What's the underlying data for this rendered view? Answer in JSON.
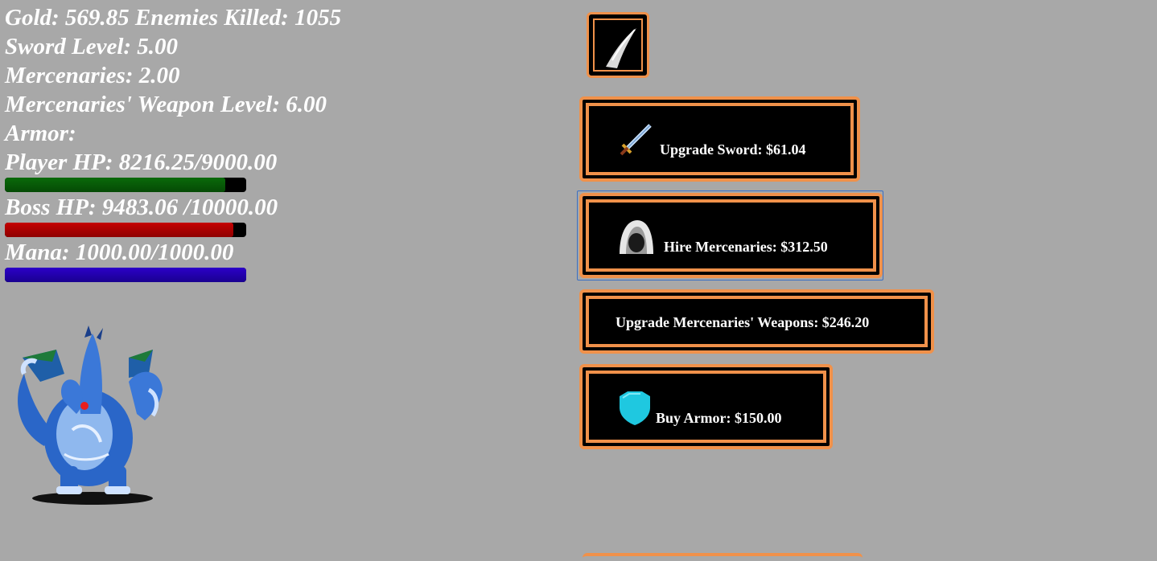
{
  "stats": {
    "gold_line": "Gold: 569.85 Enemies Killed: 1055",
    "sword_level": "Sword Level: 5.00",
    "mercenaries": "Mercenaries: 2.00",
    "merc_weapon_level": "Mercenaries' Weapon Level: 6.00",
    "armor": "Armor:",
    "player_hp": "Player HP: 8216.25/9000.00",
    "boss_hp": "Boss HP: 9483.06 /10000.00",
    "mana": "Mana: 1000.00/1000.00"
  },
  "bars": {
    "player_hp_fraction": 0.913,
    "boss_hp_fraction": 0.948,
    "mana_fraction": 1.0,
    "colors": {
      "hp": "#0a6a0a",
      "boss": "#c40000",
      "mana": "#2c00c8"
    }
  },
  "enemy": {
    "icon": "blue-three-headed-dragon-sprite"
  },
  "skill": {
    "icon": "slash-skill-icon"
  },
  "shop": {
    "upgrade_sword": {
      "label": "Upgrade Sword: $61.04",
      "icon": "sword-icon"
    },
    "hire_mercenaries": {
      "label": "Hire Mercenaries: $312.50",
      "icon": "hooded-mercenary-icon"
    },
    "upgrade_merc_weapons": {
      "label": "Upgrade Mercenaries' Weapons: $246.20"
    },
    "buy_armor": {
      "label": "Buy Armor: $150.00",
      "icon": "shield-icon"
    }
  },
  "theme": {
    "background": "#a8a8a8",
    "button_border": "#f0914a",
    "button_fill": "#000000"
  }
}
